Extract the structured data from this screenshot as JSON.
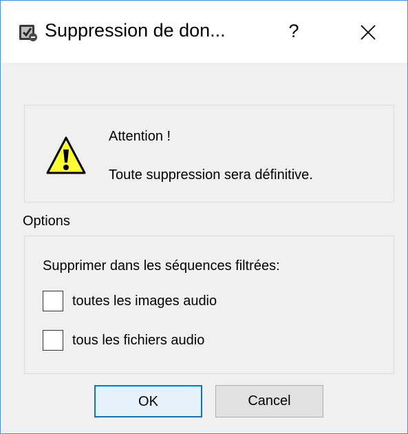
{
  "window": {
    "title": "Suppression de don...",
    "help_label": "?"
  },
  "warning": {
    "heading": "Attention !",
    "message": "Toute suppression sera définitive."
  },
  "options": {
    "group_label": "Options",
    "description": "Supprimer dans les séquences filtrées:",
    "checkboxes": [
      {
        "label": "toutes les images audio",
        "checked": false
      },
      {
        "label": "tous les fichiers audio",
        "checked": false
      }
    ]
  },
  "buttons": {
    "ok_label": "OK",
    "cancel_label": "Cancel"
  },
  "icons": {
    "title": "app-dialog-icon",
    "warning": "warning-triangle-icon",
    "close": "close-icon"
  },
  "colors": {
    "accent": "#0078d7",
    "warning_yellow": "#ffff33",
    "dialog_bg": "#f0f0f0"
  }
}
